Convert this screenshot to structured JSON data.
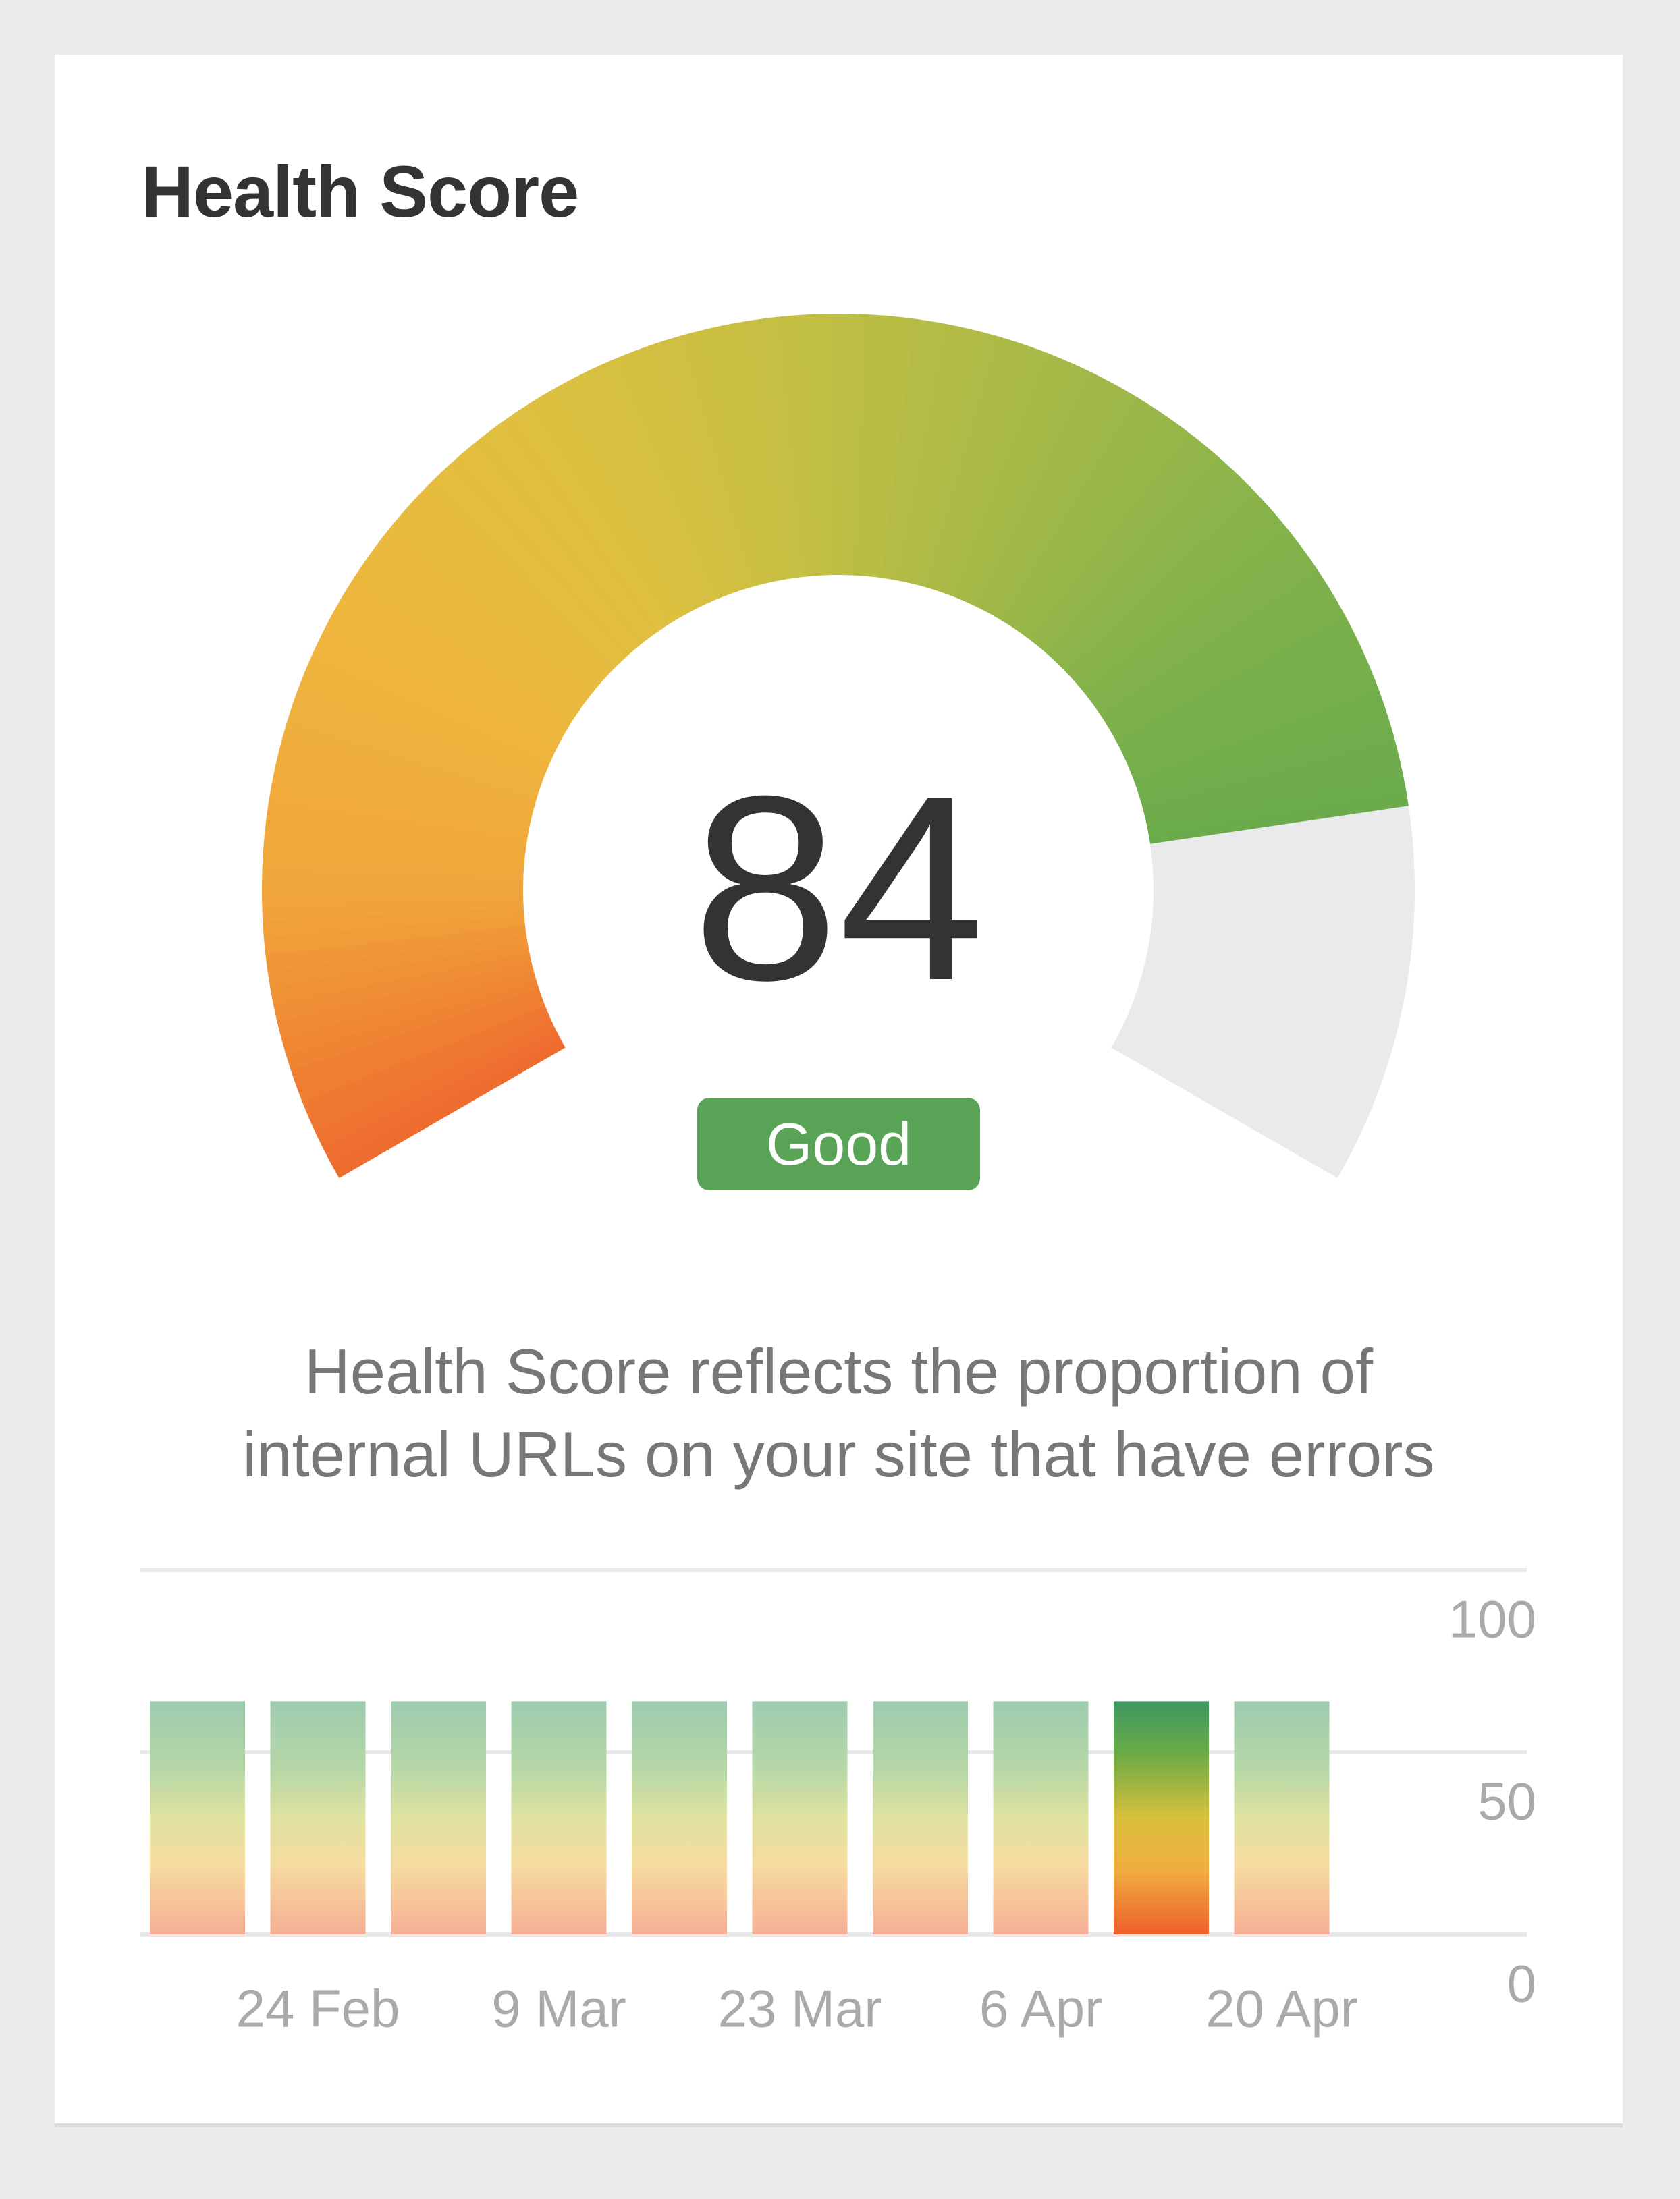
{
  "card": {
    "title": "Health Score",
    "score": "84",
    "score_value": 84,
    "score_max": 100,
    "status_label": "Good",
    "status_color": "#58a356",
    "description_line1": "Health Score reflects the proportion of",
    "description_line2": "internal URLs on your site that have errors"
  },
  "chart_data": {
    "type": "bar",
    "x_tick_labels": [
      "",
      "24 Feb",
      "",
      "9 Mar",
      "",
      "23 Mar",
      "",
      "6 Apr",
      "",
      "20 Apr"
    ],
    "values": [
      64,
      64,
      64,
      64,
      64,
      64,
      64,
      64,
      64,
      64
    ],
    "highlighted_index": 8,
    "y_ticks": [
      "100",
      "50",
      "0"
    ],
    "ylim": [
      0,
      100
    ],
    "grid": true,
    "y_axis_position": "right"
  },
  "colors": {
    "gauge_gradient": [
      "#ee6a2e",
      "#f0a53a",
      "#efb63e",
      "#dfc040",
      "#c3bf43",
      "#a5b947",
      "#82b24b",
      "#6aab4c"
    ],
    "gauge_track": "#eaeaec"
  }
}
